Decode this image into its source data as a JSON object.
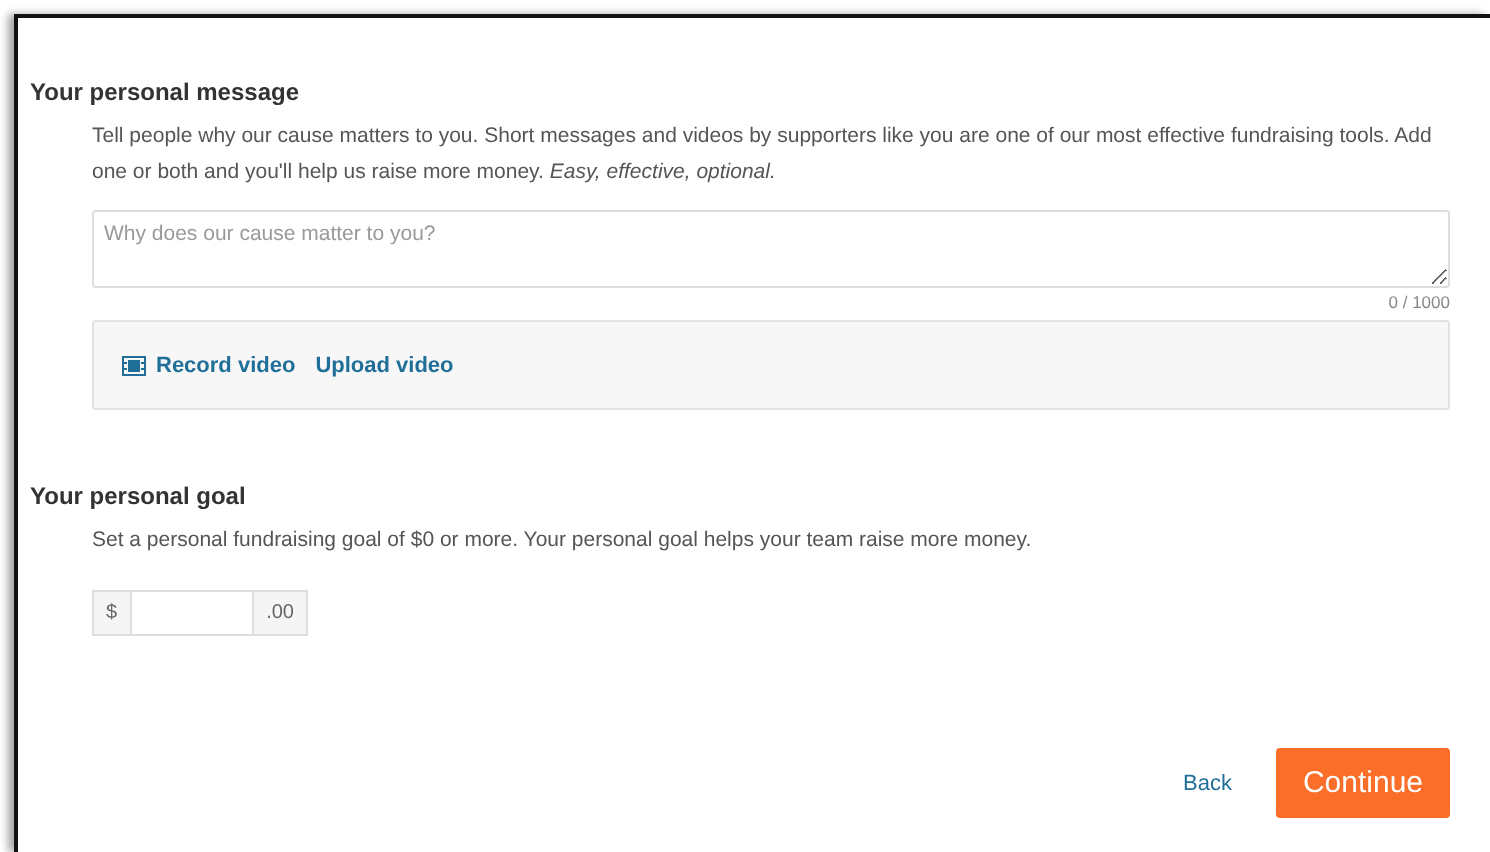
{
  "message_section": {
    "heading": "Your personal message",
    "description": "Tell people why our cause matters to you. Short messages and videos by supporters like you are one of our most effective fundraising tools. Add one or both and you'll help us raise more money. *Easy, effective, optional.*",
    "field": {
      "placeholder": "Why does our cause matter to you?"
    },
    "counter": "0 / 1000",
    "video_links": [
      "Record video",
      "Upload video"
    ]
  },
  "goal_section": {
    "heading": "Your personal goal",
    "description": "Set a personal fundraising goal of $0 or more. Your personal goal helps your team raise more money.",
    "currency_prefix": "$",
    "currency_suffix": ".00"
  },
  "footer": {
    "back": "Back",
    "continue": "Continue"
  }
}
